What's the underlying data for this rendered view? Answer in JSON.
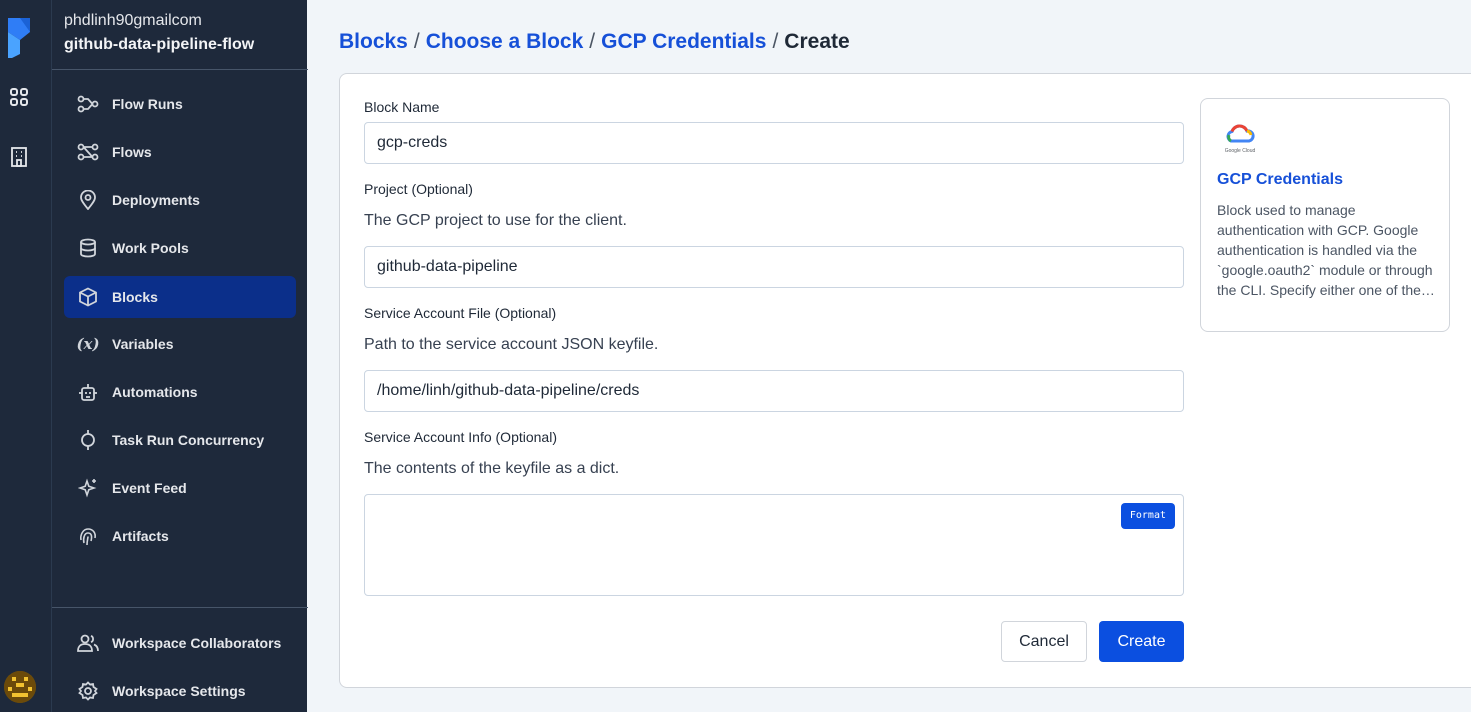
{
  "workspace": {
    "account": "phdlinh90gmailcom",
    "name": "github-data-pipeline-flow"
  },
  "sidebar": {
    "items": [
      {
        "label": "Flow Runs",
        "icon": "flow-runs-icon"
      },
      {
        "label": "Flows",
        "icon": "flows-icon"
      },
      {
        "label": "Deployments",
        "icon": "location-pin-icon"
      },
      {
        "label": "Work Pools",
        "icon": "database-icon"
      },
      {
        "label": "Blocks",
        "icon": "cube-icon",
        "active": true
      },
      {
        "label": "Variables",
        "icon": "variable-icon"
      },
      {
        "label": "Automations",
        "icon": "robot-icon"
      },
      {
        "label": "Task Run Concurrency",
        "icon": "concurrency-icon"
      },
      {
        "label": "Event Feed",
        "icon": "sparkle-icon"
      },
      {
        "label": "Artifacts",
        "icon": "fingerprint-icon"
      }
    ],
    "bottom_items": [
      {
        "label": "Workspace Collaborators",
        "icon": "users-icon"
      },
      {
        "label": "Workspace Settings",
        "icon": "gear-icon"
      }
    ]
  },
  "breadcrumb": {
    "items": [
      "Blocks",
      "Choose a Block",
      "GCP Credentials"
    ],
    "current": "Create",
    "separator": "/"
  },
  "form": {
    "block_name_label": "Block Name",
    "block_name_value": "gcp-creds",
    "project_label": "Project (Optional)",
    "project_desc": "The GCP project to use for the client.",
    "project_value": "github-data-pipeline",
    "sa_file_label": "Service Account File (Optional)",
    "sa_file_desc": "Path to the service account JSON keyfile.",
    "sa_file_value": "/home/linh/github-data-pipeline/creds",
    "sa_info_label": "Service Account Info (Optional)",
    "sa_info_desc": "The contents of the keyfile as a dict.",
    "format_label": "Format",
    "cancel_label": "Cancel",
    "create_label": "Create"
  },
  "info_card": {
    "logo_text": "Google Cloud",
    "title": "GCP Credentials",
    "description": "Block used to manage authentication with GCP. Google authentication is handled via the `google.oauth2` module or through the CLI. Specify either one of the `service account file` or `service account info`."
  },
  "colors": {
    "sidebar_bg": "#1e293b",
    "active_bg": "#0b2f8a",
    "accent": "#1650d8",
    "primary_button": "#0b4fe0"
  }
}
